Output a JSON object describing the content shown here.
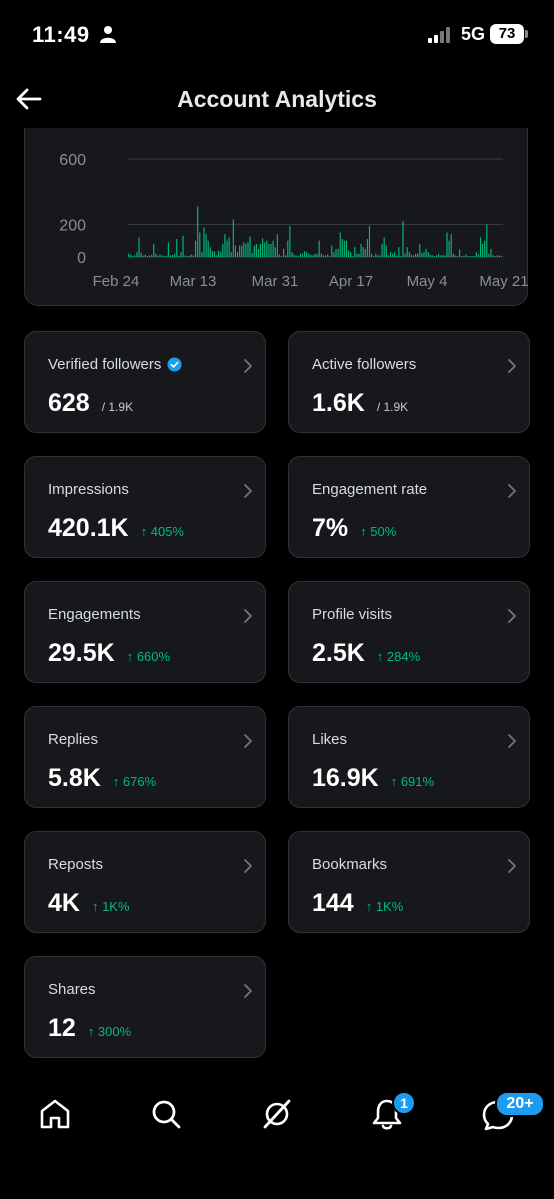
{
  "status_bar": {
    "time": "11:49",
    "network": "5G",
    "battery": "73"
  },
  "header": {
    "title": "Account Analytics"
  },
  "chart_data": {
    "type": "bar",
    "y_ticks": [
      "600",
      "200",
      "0"
    ],
    "y_tick_values": [
      600,
      200,
      0
    ],
    "x_tick_labels": [
      "Feb 24",
      "Mar 13",
      "Mar 31",
      "Apr 17",
      "May 4",
      "May 21"
    ],
    "ylim": [
      0,
      600
    ],
    "color": "#00ba7c",
    "values": [
      20,
      15,
      5,
      10,
      30,
      120,
      25,
      8,
      15,
      5,
      10,
      12,
      80,
      20,
      8,
      15,
      10,
      5,
      8,
      90,
      10,
      12,
      20,
      110,
      8,
      30,
      130,
      10,
      5,
      8,
      15,
      10,
      100,
      310,
      150,
      30,
      180,
      140,
      100,
      60,
      35,
      35,
      10,
      40,
      30,
      80,
      140,
      100,
      120,
      30,
      230,
      70,
      30,
      70,
      70,
      90,
      80,
      90,
      125,
      25,
      70,
      80,
      50,
      80,
      115,
      90,
      100,
      80,
      80,
      100,
      60,
      140,
      15,
      5,
      50,
      10,
      100,
      190,
      30,
      15,
      10,
      5,
      20,
      20,
      35,
      30,
      20,
      15,
      10,
      20,
      20,
      100,
      20,
      10,
      10,
      15,
      5,
      70,
      30,
      50,
      50,
      150,
      110,
      100,
      100,
      40,
      30,
      5,
      60,
      20,
      20,
      80,
      60,
      50,
      110,
      190,
      20,
      5,
      20,
      10,
      10,
      80,
      120,
      70,
      10,
      30,
      20,
      30,
      10,
      60,
      5,
      220,
      20,
      60,
      30,
      15,
      10,
      20,
      20,
      80,
      25,
      30,
      50,
      30,
      15,
      10,
      5,
      10,
      20,
      10,
      10,
      10,
      150,
      100,
      140,
      20,
      10,
      5,
      45,
      5,
      5,
      15,
      5,
      5,
      5,
      5,
      30,
      15,
      120,
      80,
      100,
      200,
      20,
      50,
      10,
      5,
      10,
      10,
      5
    ]
  },
  "cards": [
    {
      "label": "Verified followers",
      "value": "628",
      "sub": "/ 1.9K",
      "change": "",
      "verified": true
    },
    {
      "label": "Active followers",
      "value": "1.6K",
      "sub": "/ 1.9K",
      "change": ""
    },
    {
      "label": "Impressions",
      "value": "420.1K",
      "sub": "",
      "change": "↑ 405%"
    },
    {
      "label": "Engagement rate",
      "value": "7%",
      "sub": "",
      "change": "↑ 50%"
    },
    {
      "label": "Engagements",
      "value": "29.5K",
      "sub": "",
      "change": "↑ 660%"
    },
    {
      "label": "Profile visits",
      "value": "2.5K",
      "sub": "",
      "change": "↑ 284%"
    },
    {
      "label": "Replies",
      "value": "5.8K",
      "sub": "",
      "change": "↑ 676%"
    },
    {
      "label": "Likes",
      "value": "16.9K",
      "sub": "",
      "change": "↑ 691%"
    },
    {
      "label": "Reposts",
      "value": "4K",
      "sub": "",
      "change": "↑ 1K%"
    },
    {
      "label": "Bookmarks",
      "value": "144",
      "sub": "",
      "change": "↑ 1K%"
    },
    {
      "label": "Shares",
      "value": "12",
      "sub": "",
      "change": "↑ 300%"
    }
  ],
  "tabbar": {
    "notifications_badge": "1",
    "messages_badge": "20+"
  },
  "colors": {
    "background": "#000000",
    "card": "#16181c",
    "border": "#2f3336",
    "accent_green": "#00ba7c",
    "accent_blue": "#1d9bf0"
  },
  "icons": [
    "person-icon",
    "back-arrow-icon",
    "verified-badge-icon",
    "chevron-right-icon",
    "home-icon",
    "search-icon",
    "grok-icon",
    "bell-icon",
    "messages-icon"
  ]
}
